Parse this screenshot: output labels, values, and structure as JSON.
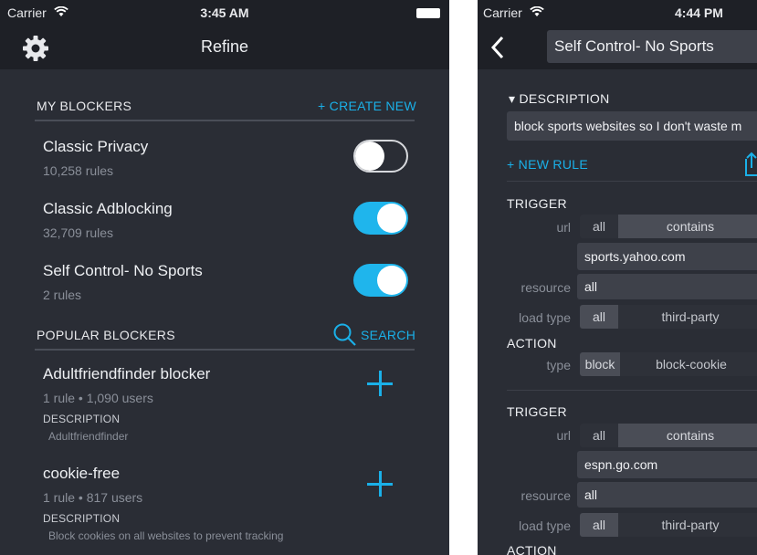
{
  "left": {
    "status": {
      "carrier": "Carrier",
      "time": "3:45 AM"
    },
    "nav": {
      "title": "Refine",
      "settings_icon": "gear-icon"
    },
    "my_blockers": {
      "header": "MY BLOCKERS",
      "create_label": "+ CREATE NEW",
      "items": [
        {
          "name": "Classic Privacy",
          "rules": "10,258 rules",
          "enabled": false
        },
        {
          "name": "Classic Adblocking",
          "rules": "32,709 rules",
          "enabled": true
        },
        {
          "name": "Self Control- No Sports",
          "rules": "2 rules",
          "enabled": true
        }
      ]
    },
    "popular": {
      "header": "POPULAR BLOCKERS",
      "search_label": "SEARCH",
      "items": [
        {
          "name": "Adultfriendfinder blocker",
          "meta": "1 rule • 1,090 users",
          "desc_label": "DESCRIPTION",
          "desc": "Adultfriendfinder"
        },
        {
          "name": "cookie-free",
          "meta": "1 rule • 817 users",
          "desc_label": "DESCRIPTION",
          "desc": "Block cookies on all websites to prevent tracking"
        }
      ]
    }
  },
  "right": {
    "status": {
      "carrier": "Carrier",
      "time": "4:44 PM"
    },
    "nav": {
      "title": "Self Control- No Sports",
      "back_icon": "chevron-left-icon"
    },
    "description_header": "▾ DESCRIPTION",
    "description_value": "block sports websites so I don't waste m",
    "new_rule_label": "+ NEW RULE",
    "rules": [
      {
        "trigger_header": "TRIGGER",
        "url_label": "url",
        "url_options": [
          "all",
          "contains"
        ],
        "url_value": "sports.yahoo.com",
        "resource_label": "resource",
        "resource_value": "all",
        "load_type_label": "load type",
        "load_type_options": [
          "all",
          "third-party"
        ],
        "action_header": "ACTION",
        "type_label": "type",
        "type_options": [
          "block",
          "block-cookie"
        ]
      },
      {
        "trigger_header": "TRIGGER",
        "url_label": "url",
        "url_options": [
          "all",
          "contains"
        ],
        "url_value": "espn.go.com",
        "resource_label": "resource",
        "resource_value": "all",
        "load_type_label": "load type",
        "load_type_options": [
          "all",
          "third-party"
        ],
        "action_header": "ACTION"
      }
    ]
  },
  "colors": {
    "accent": "#1ab0e8",
    "background": "#2a2d35",
    "bar": "#1e2026",
    "toggle_on": "#1fb5ec"
  }
}
